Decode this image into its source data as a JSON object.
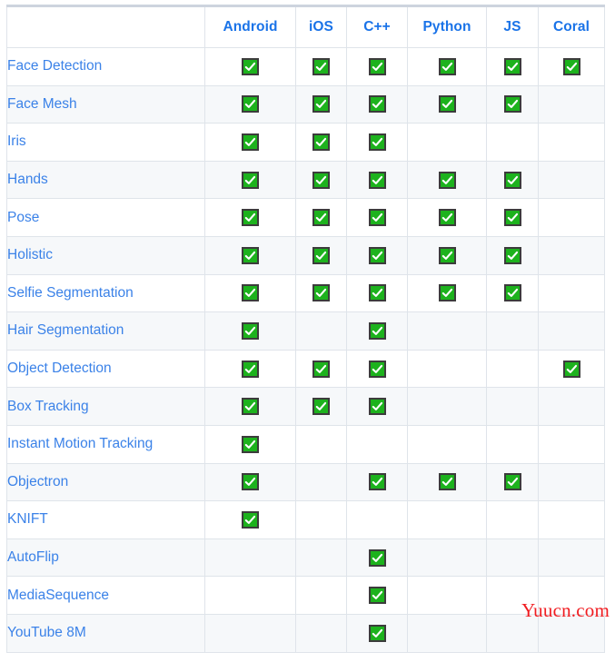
{
  "table": {
    "columns": [
      {
        "key": "solution",
        "label": ""
      },
      {
        "key": "android",
        "label": "Android"
      },
      {
        "key": "ios",
        "label": "iOS"
      },
      {
        "key": "cpp",
        "label": "C++"
      },
      {
        "key": "python",
        "label": "Python"
      },
      {
        "key": "js",
        "label": "JS"
      },
      {
        "key": "coral",
        "label": "Coral"
      }
    ],
    "rows": [
      {
        "solution": "Face Detection",
        "android": true,
        "ios": true,
        "cpp": true,
        "python": true,
        "js": true,
        "coral": true
      },
      {
        "solution": "Face Mesh",
        "android": true,
        "ios": true,
        "cpp": true,
        "python": true,
        "js": true,
        "coral": false
      },
      {
        "solution": "Iris",
        "android": true,
        "ios": true,
        "cpp": true,
        "python": false,
        "js": false,
        "coral": false
      },
      {
        "solution": "Hands",
        "android": true,
        "ios": true,
        "cpp": true,
        "python": true,
        "js": true,
        "coral": false
      },
      {
        "solution": "Pose",
        "android": true,
        "ios": true,
        "cpp": true,
        "python": true,
        "js": true,
        "coral": false
      },
      {
        "solution": "Holistic",
        "android": true,
        "ios": true,
        "cpp": true,
        "python": true,
        "js": true,
        "coral": false
      },
      {
        "solution": "Selfie Segmentation",
        "android": true,
        "ios": true,
        "cpp": true,
        "python": true,
        "js": true,
        "coral": false
      },
      {
        "solution": "Hair Segmentation",
        "android": true,
        "ios": false,
        "cpp": true,
        "python": false,
        "js": false,
        "coral": false
      },
      {
        "solution": "Object Detection",
        "android": true,
        "ios": true,
        "cpp": true,
        "python": false,
        "js": false,
        "coral": true
      },
      {
        "solution": "Box Tracking",
        "android": true,
        "ios": true,
        "cpp": true,
        "python": false,
        "js": false,
        "coral": false
      },
      {
        "solution": "Instant Motion Tracking",
        "android": true,
        "ios": false,
        "cpp": false,
        "python": false,
        "js": false,
        "coral": false
      },
      {
        "solution": "Objectron",
        "android": true,
        "ios": false,
        "cpp": true,
        "python": true,
        "js": true,
        "coral": false
      },
      {
        "solution": "KNIFT",
        "android": true,
        "ios": false,
        "cpp": false,
        "python": false,
        "js": false,
        "coral": false
      },
      {
        "solution": "AutoFlip",
        "android": false,
        "ios": false,
        "cpp": true,
        "python": false,
        "js": false,
        "coral": false
      },
      {
        "solution": "MediaSequence",
        "android": false,
        "ios": false,
        "cpp": true,
        "python": false,
        "js": false,
        "coral": false
      },
      {
        "solution": "YouTube 8M",
        "android": false,
        "ios": false,
        "cpp": true,
        "python": false,
        "js": false,
        "coral": false
      }
    ],
    "supported_icon": "green-check-icon"
  },
  "watermark": {
    "text": "Yuucn.com",
    "color": "#f01c20"
  },
  "colors": {
    "link_blue": "#3b82e8",
    "header_blue": "#1a73e8",
    "check_green": "#1db21d",
    "stripe": "#f6f8fa",
    "border": "#dfe4ea",
    "top_border": "#cdd4de"
  }
}
